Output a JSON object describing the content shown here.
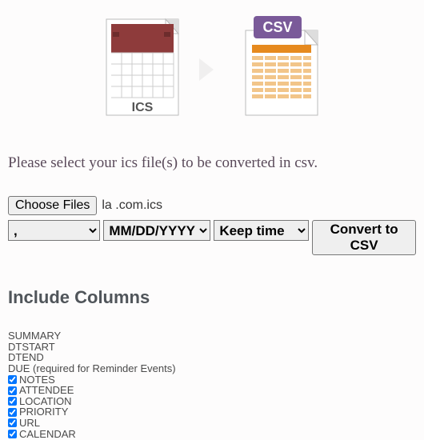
{
  "graphics": {
    "left_label": "ICS",
    "right_label": "CSV"
  },
  "instruction": "Please select your ics file(s) to be converted in csv.",
  "file_picker": {
    "button_label": "Choose Files",
    "selected_text": "la        .com.ics"
  },
  "selects": {
    "delimiter_value": ",",
    "date_format_value": "MM/DD/YYYY",
    "time_value": "Keep time"
  },
  "convert_button_label": "Convert to CSV",
  "columns_heading": "Include Columns",
  "columns_fixed": [
    "SUMMARY",
    "DTSTART",
    "DTEND",
    "DUE (required for Reminder Events)"
  ],
  "columns_checkable": [
    "NOTES",
    "ATTENDEE",
    "LOCATION",
    "PRIORITY",
    "URL",
    "CALENDAR"
  ]
}
